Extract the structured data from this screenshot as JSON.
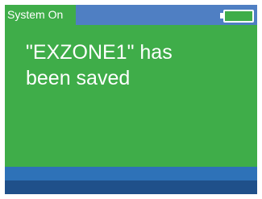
{
  "status_bar": {
    "label": "System On",
    "battery_icon": "battery-empty-icon"
  },
  "message": {
    "line1": "\"EXZONE1\" has",
    "line2": "been saved"
  },
  "colors": {
    "screen_green": "#3fad49",
    "status_blue": "#4f7fc3",
    "band_blue": "#2e72b8",
    "bottom_blue": "#1f508a",
    "text": "#ffffff"
  }
}
